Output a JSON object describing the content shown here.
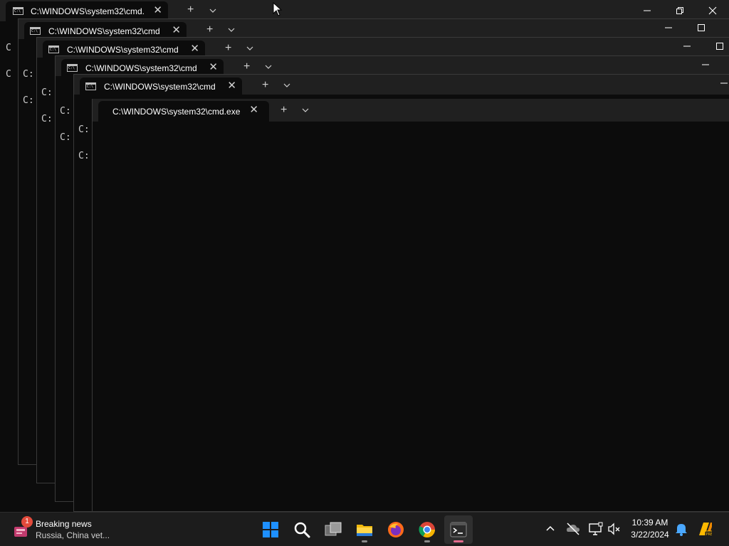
{
  "windows": [
    {
      "id": "w0",
      "title": "C:\\WINDOWS\\system32\\cmd.",
      "prompt": "C"
    },
    {
      "id": "w1",
      "title": "C:\\WINDOWS\\system32\\cmd",
      "prompt": "C:"
    },
    {
      "id": "w2",
      "title": "C:\\WINDOWS\\system32\\cmd",
      "prompt": "C:"
    },
    {
      "id": "w3",
      "title": "C:\\WINDOWS\\system32\\cmd",
      "prompt": "C:"
    },
    {
      "id": "w4",
      "title": "C:\\WINDOWS\\system32\\cmd",
      "prompt": "C:"
    },
    {
      "id": "w5",
      "title": "C:\\WINDOWS\\system32\\cmd.exe",
      "prompt": ""
    }
  ],
  "tab_close_glyph": "✕",
  "new_tab_glyph": "+",
  "taskbar": {
    "news_title": "Breaking news",
    "news_subtitle": "Russia, China vet...",
    "news_badge": "1",
    "apps": [
      "start-icon",
      "search-icon",
      "task-view-icon",
      "file-explorer-icon",
      "firefox-icon",
      "chrome-icon",
      "terminal-icon"
    ],
    "time": "10:39 AM",
    "date": "3/22/2024"
  },
  "colors": {
    "terminal_bg": "#0c0c0c",
    "tabbar_bg": "#202020",
    "taskbar_bg": "#1c1c1c",
    "accent": "#0078d4"
  }
}
